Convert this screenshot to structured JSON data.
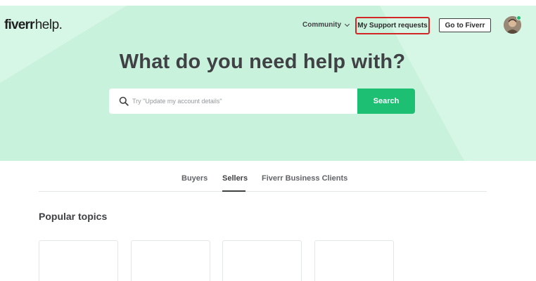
{
  "header": {
    "logo_brand": "fiverr",
    "logo_suffix": "help.",
    "community_label": "Community",
    "support_requests_label": "My Support requests",
    "go_to_fiverr_label": "Go to Fiverr"
  },
  "hero": {
    "headline": "What do you need help with?",
    "search_placeholder": "Try \"Update my account details\"",
    "search_button_label": "Search"
  },
  "tabs": [
    {
      "label": "Buyers",
      "active": false
    },
    {
      "label": "Sellers",
      "active": true
    },
    {
      "label": "Fiverr Business Clients",
      "active": false
    }
  ],
  "section": {
    "title": "Popular topics"
  },
  "colors": {
    "hero_bg": "#d7f7e6",
    "brand_green": "#1dbf73",
    "highlight_red": "#d32727",
    "text_dark": "#404145"
  },
  "icons": {
    "search": "search-icon",
    "chevron": "chevron-down-icon",
    "avatar": "user-avatar"
  }
}
